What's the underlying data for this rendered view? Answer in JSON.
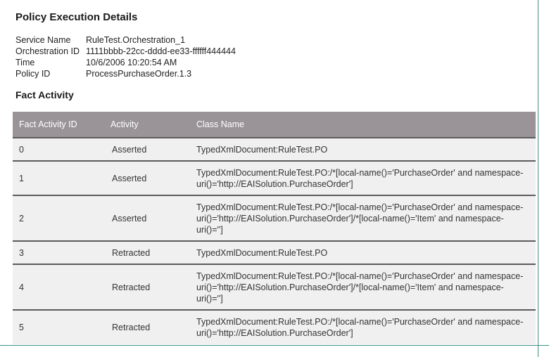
{
  "page_title": "Policy Execution Details",
  "details": [
    {
      "label": "Service Name",
      "value": "RuleTest.Orchestration_1"
    },
    {
      "label": "Orchestration ID",
      "value": "1111bbbb-22cc-dddd-ee33-ffffff444444"
    },
    {
      "label": "Time",
      "value": "10/6/2006 10:20:54 AM"
    },
    {
      "label": "Policy ID",
      "value": "ProcessPurchaseOrder.1.3"
    }
  ],
  "fact_activity": {
    "title": "Fact Activity",
    "columns": [
      "Fact Activity ID",
      "Activity",
      "Class Name"
    ],
    "rows": [
      {
        "id": "0",
        "activity": "Asserted",
        "class_name": "TypedXmlDocument:RuleTest.PO"
      },
      {
        "id": "1",
        "activity": "Asserted",
        "class_name": "TypedXmlDocument:RuleTest.PO:/*[local-name()='PurchaseOrder' and namespace-uri()='http://EAISolution.PurchaseOrder']"
      },
      {
        "id": "2",
        "activity": "Asserted",
        "class_name": "TypedXmlDocument:RuleTest.PO:/*[local-name()='PurchaseOrder' and namespace-uri()='http://EAISolution.PurchaseOrder']/*[local-name()='Item' and namespace-uri()='']"
      },
      {
        "id": "3",
        "activity": "Retracted",
        "class_name": "TypedXmlDocument:RuleTest.PO"
      },
      {
        "id": "4",
        "activity": "Retracted",
        "class_name": "TypedXmlDocument:RuleTest.PO:/*[local-name()='PurchaseOrder' and namespace-uri()='http://EAISolution.PurchaseOrder']/*[local-name()='Item' and namespace-uri()='']"
      },
      {
        "id": "5",
        "activity": "Retracted",
        "class_name": "TypedXmlDocument:RuleTest.PO:/*[local-name()='PurchaseOrder' and namespace-uri()='http://EAISolution.PurchaseOrder']"
      }
    ]
  }
}
